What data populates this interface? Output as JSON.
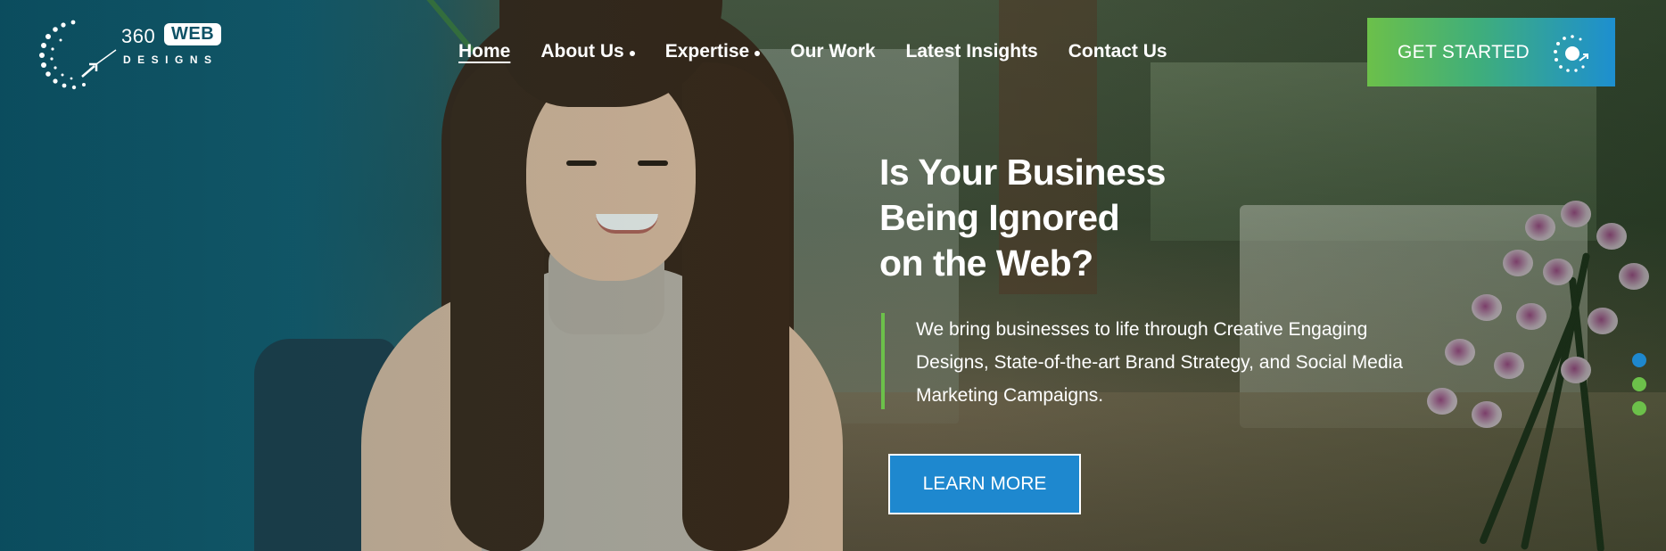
{
  "brand": {
    "logo_number": "360",
    "logo_web": "WEB",
    "logo_designs": "DESIGNS"
  },
  "nav": {
    "items": [
      {
        "label": "Home",
        "active": true,
        "has_dropdown": false
      },
      {
        "label": "About Us",
        "active": false,
        "has_dropdown": true
      },
      {
        "label": "Expertise",
        "active": false,
        "has_dropdown": true
      },
      {
        "label": "Our Work",
        "active": false,
        "has_dropdown": false
      },
      {
        "label": "Latest Insights",
        "active": false,
        "has_dropdown": false
      },
      {
        "label": "Contact Us",
        "active": false,
        "has_dropdown": false
      }
    ]
  },
  "cta": {
    "label": "GET STARTED",
    "icon": "circle-target-icon"
  },
  "hero": {
    "headline_lines": [
      "Is Your Business",
      "Being Ignored",
      "on the Web?"
    ],
    "lead_text": "We bring businesses to life through Creative Engaging Designs, State-of-the-art Brand Strategy, and Social Media Marketing Campaigns.",
    "button_label": "LEARN MORE"
  },
  "slider": {
    "slide_count": 3,
    "active_index": 0
  },
  "colors": {
    "accent_green": "#6cc04a",
    "accent_blue": "#1e88cf",
    "teal": "#0f5266",
    "pager_active": "#1e88cf",
    "pager_inactive": "#6cc04a"
  }
}
